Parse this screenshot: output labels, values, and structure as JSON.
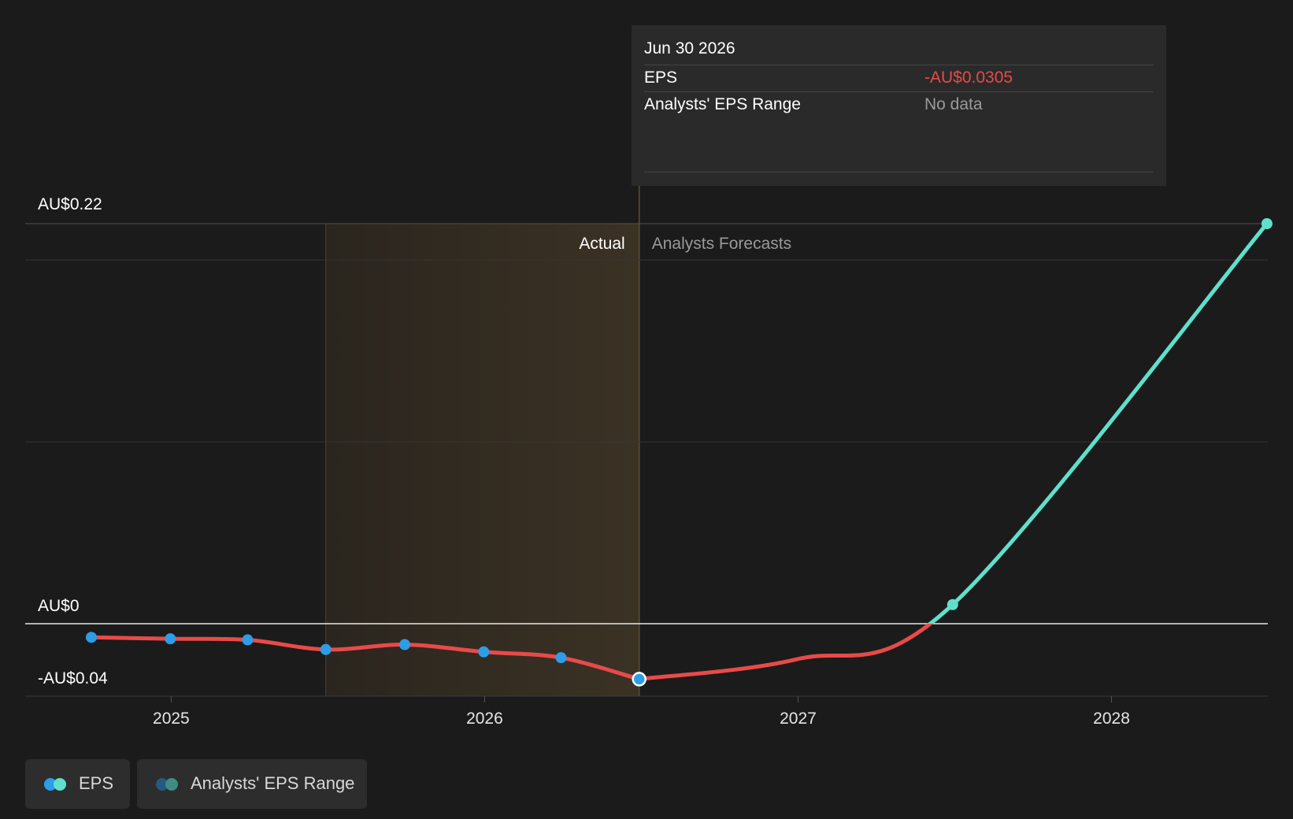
{
  "tooltip": {
    "date": "Jun 30 2026",
    "rows": [
      {
        "label": "EPS",
        "value": "-AU$0.0305",
        "value_color": "#e84a4a"
      },
      {
        "label": "Analysts' EPS Range",
        "value": "No data",
        "value_color": "#9a9a9a"
      }
    ]
  },
  "legend": {
    "eps_label": "EPS",
    "range_label": "Analysts' EPS Range"
  },
  "colors": {
    "background": "#1b1b1b",
    "actual_line": "#e84a4a",
    "forecast_line": "#5fe0cc",
    "actual_points": "#2e9de8",
    "actual_band": "#3b3224",
    "range_dot_blue": "#245a80",
    "range_dot_teal": "#3f8c84"
  },
  "chart_data": {
    "type": "line",
    "y_labels": [
      "AU$0.22",
      "AU$0",
      "-AU$0.04"
    ],
    "x_tick_labels": [
      "2025",
      "2026",
      "2027",
      "2028"
    ],
    "section_labels": {
      "actual": "Actual",
      "forecast": "Analysts Forecasts"
    },
    "ylim": [
      -0.04,
      0.22
    ],
    "xlim": [
      "2024-07-15",
      "2028-07-01"
    ],
    "actual_band": [
      "2025-06-30",
      "2026-06-30"
    ],
    "series": [
      {
        "name": "EPS",
        "segment": "actual",
        "x": [
          "2024-09-30",
          "2024-12-31",
          "2025-03-31",
          "2025-06-30",
          "2025-09-30",
          "2025-12-31",
          "2026-03-31",
          "2026-06-30"
        ],
        "values": [
          -0.0075,
          -0.0083,
          -0.0089,
          -0.0142,
          -0.0115,
          -0.0155,
          -0.0187,
          -0.0305
        ]
      },
      {
        "name": "EPS",
        "segment": "forecast",
        "x": [
          "2026-06-30",
          "2026-12-31",
          "2027-06-30",
          "2028-06-30"
        ],
        "values": [
          -0.0305,
          -0.0195,
          0.0105,
          0.22
        ]
      }
    ],
    "highlight": {
      "x": "2026-06-30",
      "value": -0.0305
    }
  }
}
